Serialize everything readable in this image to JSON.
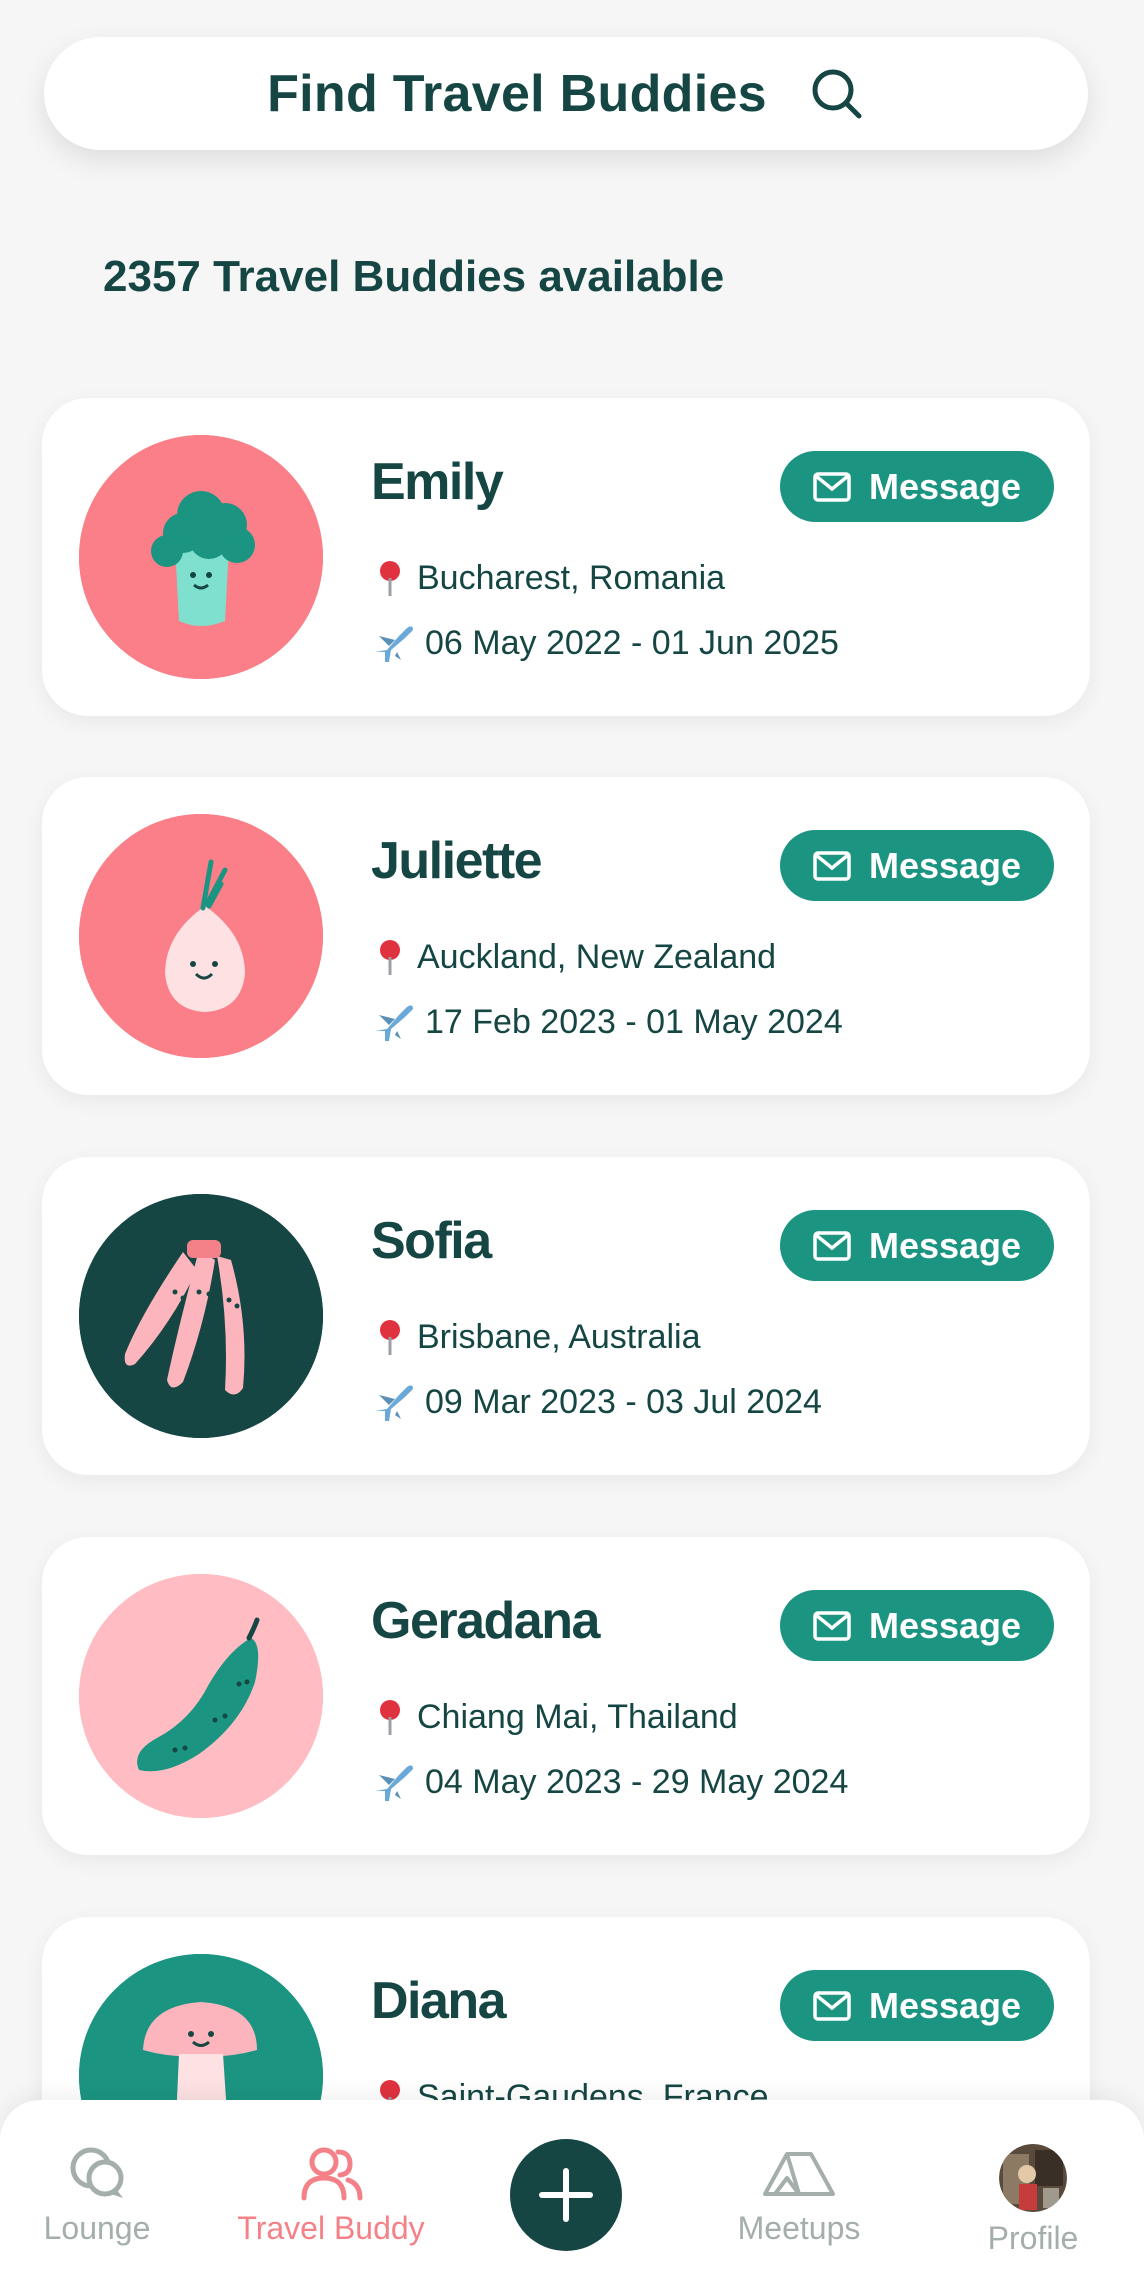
{
  "header": {
    "title": "Find Travel Buddies"
  },
  "summary": {
    "count_text": "2357 Travel Buddies available"
  },
  "buddies": [
    {
      "name": "Emily",
      "location": "Bucharest, Romania",
      "dates": "06 May 2022 - 01 Jun 2025",
      "message_label": "Message",
      "avatar": "broccoli",
      "avatar_bg": "#fa7f88"
    },
    {
      "name": "Juliette",
      "location": "Auckland, New Zealand",
      "dates": "17 Feb 2023 - 01 May 2024",
      "message_label": "Message",
      "avatar": "onion",
      "avatar_bg": "#fa7f88"
    },
    {
      "name": "Sofia",
      "location": "Brisbane, Australia",
      "dates": "09 Mar 2023 - 03 Jul 2024",
      "message_label": "Message",
      "avatar": "bananas",
      "avatar_bg": "#154643"
    },
    {
      "name": "Geradana",
      "location": "Chiang Mai, Thailand",
      "dates": "04 May 2023 - 29 May 2024",
      "message_label": "Message",
      "avatar": "peapod",
      "avatar_bg": "#ffbcc2"
    },
    {
      "name": "Diana",
      "location": "Saint-Gaudens, France",
      "dates": "",
      "message_label": "Message",
      "avatar": "mushroom",
      "avatar_bg": "#1b9582"
    }
  ],
  "nav": {
    "items": [
      {
        "label": "Lounge",
        "icon": "chat-bubbles-icon",
        "active": false
      },
      {
        "label": "Travel Buddy",
        "icon": "people-icon",
        "active": true
      },
      {
        "label": "",
        "icon": "plus-icon",
        "active": false
      },
      {
        "label": "Meetups",
        "icon": "tent-icon",
        "active": false
      },
      {
        "label": "Profile",
        "icon": "profile-photo",
        "active": false
      }
    ]
  },
  "colors": {
    "primary_dark": "#154643",
    "accent_teal": "#1b9582",
    "accent_pink": "#f58188",
    "inactive": "#a4aeab",
    "background": "#f6f6f6"
  }
}
